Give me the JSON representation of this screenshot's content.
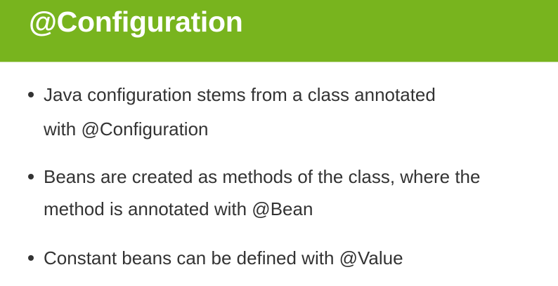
{
  "slide": {
    "title": "@Configuration",
    "header_color": "#78b41e",
    "bullets": [
      {
        "lines": [
          "Java configuration stems from a class annotated",
          "with @Configuration"
        ]
      },
      {
        "lines": [
          "Beans are created as methods of the class, where the",
          "method is annotated with @Bean"
        ]
      },
      {
        "lines": [
          "Constant beans can be defined with @Value"
        ]
      }
    ]
  }
}
